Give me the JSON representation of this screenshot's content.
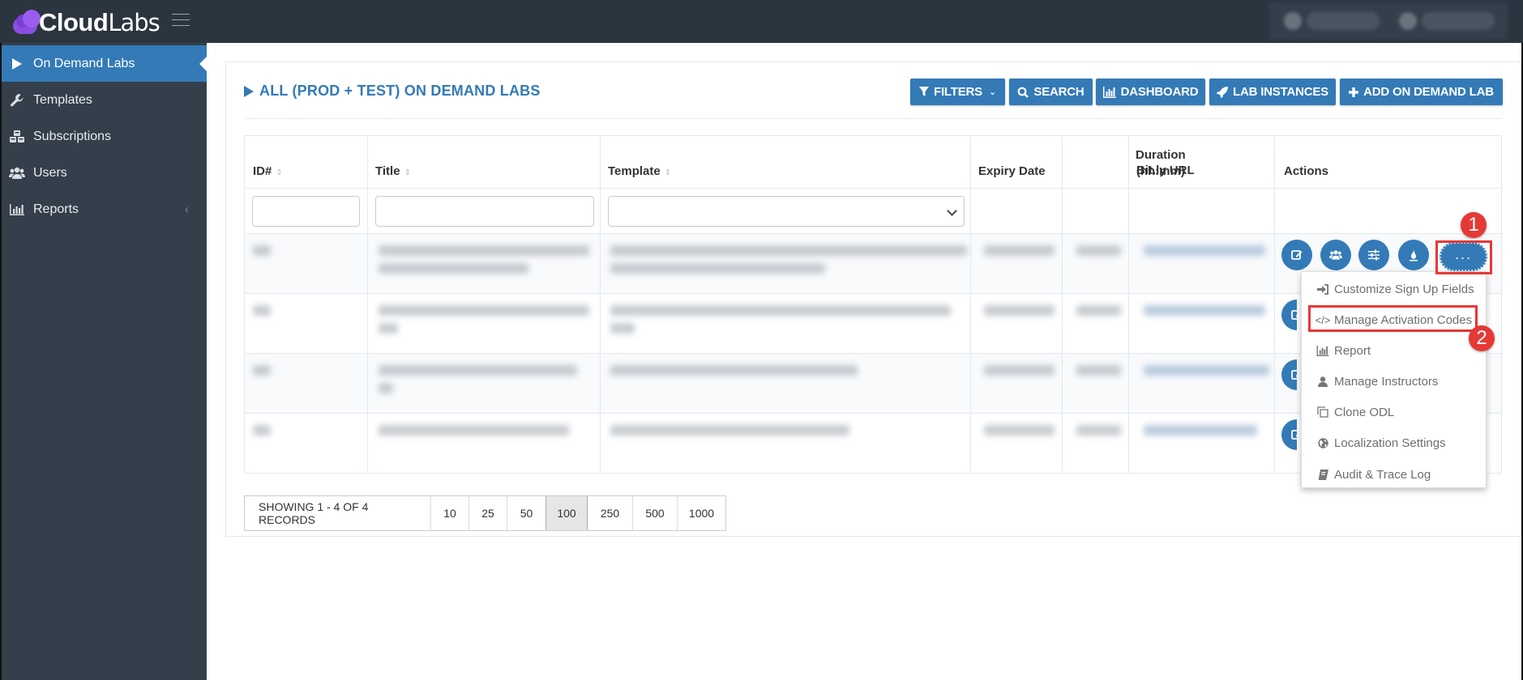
{
  "app": {
    "logo_bold": "Cloud",
    "logo_thin": "Labs"
  },
  "sidebar": {
    "items": [
      {
        "label": "On Demand Labs",
        "icon": "play-icon",
        "active": true
      },
      {
        "label": "Templates",
        "icon": "wrench-icon"
      },
      {
        "label": "Subscriptions",
        "icon": "cubes-icon"
      },
      {
        "label": "Users",
        "icon": "users-icon"
      },
      {
        "label": "Reports",
        "icon": "bar-chart-icon",
        "has_submenu": true
      }
    ]
  },
  "page": {
    "title": "ALL (PROD + TEST) ON DEMAND LABS"
  },
  "toolbar": {
    "filters": "FILTERS",
    "search": "SEARCH",
    "dashboard": "DASHBOARD",
    "lab_instances": "LAB INSTANCES",
    "add": "ADD ON DEMAND LAB"
  },
  "table": {
    "columns": {
      "id": "ID#",
      "title": "Title",
      "template": "Template",
      "expiry": "Expiry Date",
      "duration_1": "Duration",
      "duration_2": "(hh:mm)",
      "bitly": "Bit.ly URL",
      "actions": "Actions"
    },
    "filters": {
      "id": "",
      "title": "",
      "template": ""
    },
    "rows_redacted": 4
  },
  "actions_menu": {
    "items": [
      {
        "label": "Customize Sign Up Fields",
        "icon": "sign-in-icon"
      },
      {
        "label": "Manage Activation Codes",
        "icon": "code-icon"
      },
      {
        "label": "Report",
        "icon": "bar-chart-icon"
      },
      {
        "label": "Manage Instructors",
        "icon": "user-icon"
      },
      {
        "label": "Clone ODL",
        "icon": "clone-icon"
      },
      {
        "label": "Localization Settings",
        "icon": "globe-icon"
      },
      {
        "label": "Audit & Trace Log",
        "icon": "book-icon"
      }
    ],
    "more_label": "..."
  },
  "annotations": {
    "step1": "1",
    "step2": "2"
  },
  "pager": {
    "info": "SHOWING 1 - 4 OF 4 RECORDS",
    "sizes": [
      "10",
      "25",
      "50",
      "100",
      "250",
      "500",
      "1000"
    ],
    "selected": "100"
  },
  "colors": {
    "primary": "#337ab7",
    "sidebar": "#343f4b",
    "header": "#2b3540",
    "annotation": "#e53935"
  }
}
